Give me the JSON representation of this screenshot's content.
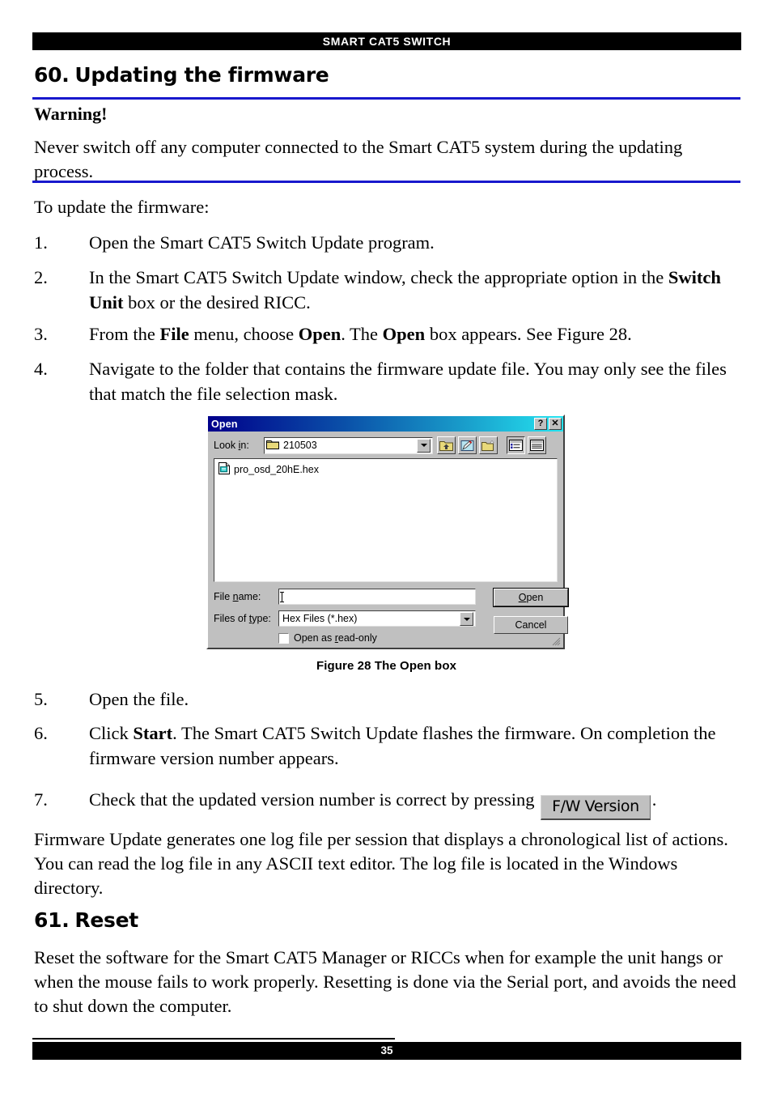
{
  "running_header": "SMART CAT5 SWITCH",
  "page_number": "35",
  "sections": {
    "firmware": {
      "number": "60.",
      "title": "Updating the firmware",
      "warning_title": "Warning!",
      "warning_body": "Never switch off any computer connected to the Smart CAT5 system during the updating process.",
      "intro": "To update the firmware:",
      "steps": [
        {
          "marker": "1.",
          "text": "Open the Smart CAT5 Switch Update program."
        },
        {
          "marker": "2.",
          "text_a": "In the Smart CAT5 Switch Update window, check the appropriate option in the ",
          "bold_a": "Switch Unit",
          "text_b": " box or the desired RICC."
        },
        {
          "marker": "3.",
          "text_a": "From the ",
          "bold_a": "File",
          "text_b": " menu, choose ",
          "bold_b": "Open",
          "text_c": ". The ",
          "bold_c": "Open",
          "text_d": " box appears. See Figure 28."
        },
        {
          "marker": "4.",
          "text": "Navigate to the folder that contains the firmware update file. You may only see the files that match the file selection mask."
        },
        {
          "marker": "5.",
          "text": "Open the file."
        },
        {
          "marker": "6.",
          "text_a": "Click ",
          "bold_a": "Start",
          "text_b": ". The Smart CAT5 Switch Update flashes the firmware. On completion the firmware version number appears."
        },
        {
          "marker": "7.",
          "text_a": "Check that the updated version number is correct by pressing ",
          "button_label": "F/W Version",
          "text_b": "."
        }
      ],
      "closing": "Firmware Update generates one log file per session that displays a chronological list of actions. You can read the log file in any ASCII text editor. The log file is located in the Windows directory."
    },
    "reset": {
      "number": "61.",
      "title": "Reset",
      "body": "Reset the software for the Smart CAT5 Manager or RICCs when for example the unit hangs or when the mouse fails to work properly. Resetting is done via the Serial port, and avoids the need to shut down the computer."
    }
  },
  "figure": {
    "caption": "Figure 28 The Open box",
    "dialog": {
      "title": "Open",
      "help_button": "?",
      "close_button": "✕",
      "look_in_label": "Look in:",
      "look_in_value": "210503",
      "toolbar_icons": [
        "up-one-level-icon",
        "create-new-folder-pencil-icon",
        "new-folder-icon",
        "list-view-icon",
        "details-view-icon"
      ],
      "files": [
        {
          "name": "pro_osd_20hE.hex",
          "icon": "hex-file-icon"
        }
      ],
      "file_name_label": "File name:",
      "file_name_value": "",
      "files_of_type_label": "Files of type:",
      "files_of_type_value": "Hex Files (*.hex)",
      "read_only_label": "Open as read-only",
      "read_only_checked": false,
      "open_button": "Open",
      "cancel_button": "Cancel"
    }
  },
  "colors": {
    "rule_blue": "#1818CD",
    "header_bar": "#000000",
    "dialog_face": "#C0C0C0",
    "title_gradient_start": "#00008B",
    "title_gradient_end": "#25E4F0"
  }
}
